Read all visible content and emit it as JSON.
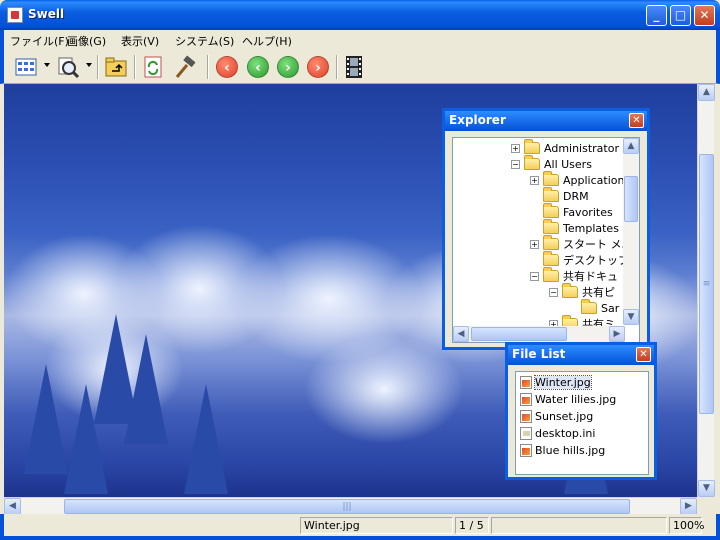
{
  "window": {
    "title": "Swell"
  },
  "title_buttons": {
    "minimize": "_",
    "maximize": "□",
    "close": "✕"
  },
  "menu": [
    "ファイル(F)",
    "画像(G)",
    "表示(V)",
    "システム(S)",
    "ヘルプ(H)"
  ],
  "toolbar": {
    "prev_symbol": "‹",
    "back_symbol": "‹",
    "forward_symbol": "›",
    "next_symbol": "›"
  },
  "explorer": {
    "title": "Explorer",
    "close_symbol": "✕",
    "tree": [
      {
        "label": "Administrator",
        "expander": "+"
      },
      {
        "label": "All Users",
        "expander": "−"
      },
      {
        "label": "Application",
        "expander": "+"
      },
      {
        "label": "DRM",
        "expander": ""
      },
      {
        "label": "Favorites",
        "expander": ""
      },
      {
        "label": "Templates",
        "expander": ""
      },
      {
        "label": "スタート メニ",
        "expander": "+"
      },
      {
        "label": "デスクトップ",
        "expander": ""
      },
      {
        "label": "共有ドキュ",
        "expander": "−"
      },
      {
        "label": "共有ピ",
        "expander": "−"
      },
      {
        "label": "Sar",
        "expander": ""
      },
      {
        "label": "共有ミ",
        "expander": "+"
      }
    ]
  },
  "file_list": {
    "title": "File List",
    "close_symbol": "✕",
    "items": [
      {
        "name": "Winter.jpg",
        "type": "jpg"
      },
      {
        "name": "Water lilies.jpg",
        "type": "jpg"
      },
      {
        "name": "Sunset.jpg",
        "type": "jpg"
      },
      {
        "name": "desktop.ini",
        "type": "ini"
      },
      {
        "name": "Blue hills.jpg",
        "type": "jpg"
      }
    ],
    "selected": "Winter.jpg"
  },
  "status": {
    "filename": "Winter.jpg",
    "position": "1 / 5",
    "zoom": "100%"
  },
  "colors": {
    "titlebar": "#0a5ee0",
    "nav_red": "#e8503a",
    "nav_green": "#3aa83a"
  }
}
